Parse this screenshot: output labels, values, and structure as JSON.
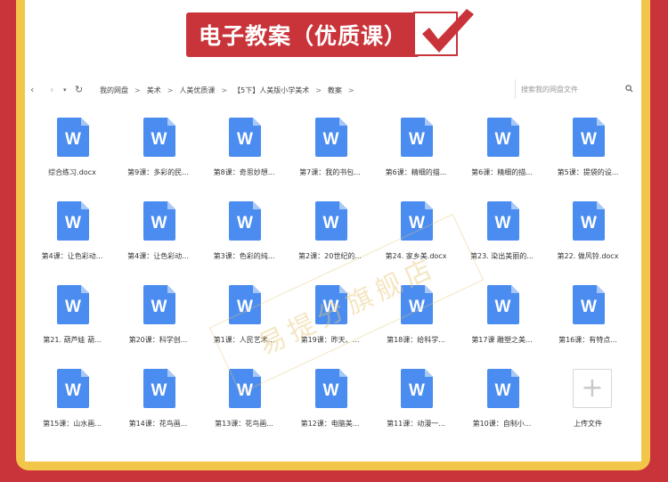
{
  "banner": {
    "title": "电子教案（优质课）"
  },
  "nav": {
    "back_icon": "chevron-left-icon",
    "forward_icon": "chevron-right-icon",
    "breadcrumbs": [
      "我的网盘",
      "美术",
      "人美优质课",
      "【5下】人美版小学美术",
      "教案"
    ],
    "search_placeholder": "搜索我的网盘文件"
  },
  "files": [
    "综合练习.docx",
    "第9课：多彩的民...",
    "第8课：奇思妙想...",
    "第7课：我的书包...",
    "第6课：精细的描...",
    "第6课：精细的描...",
    "第5课：提袋的设...",
    "第4课：让色彩动...",
    "第4课：让色彩动...",
    "第3课：色彩的纯...",
    "第2课：20世纪的...",
    "第24. 家乡美.docx",
    "第23. 染出美丽的...",
    "第22. 做风铃.docx",
    "第21. 葫芦娃 葫...",
    "第20课：科学创...",
    "第1课：人民艺术...",
    "第19课：昨天、...",
    "第18课：给科学...",
    "第17课 雕塑之美...",
    "第16课：有特点...",
    "第15课：山水画...",
    "第14课：花鸟画...",
    "第13课：花鸟画...",
    "第12课：电脑美...",
    "第11课：动漫一...",
    "第10课：自制小..."
  ],
  "upload": {
    "label": "上传文件"
  },
  "watermark": "易提分旗舰店",
  "colors": {
    "red": "#c9343a",
    "gold": "#f2c64a",
    "doc_blue": "#4a8cf0"
  }
}
